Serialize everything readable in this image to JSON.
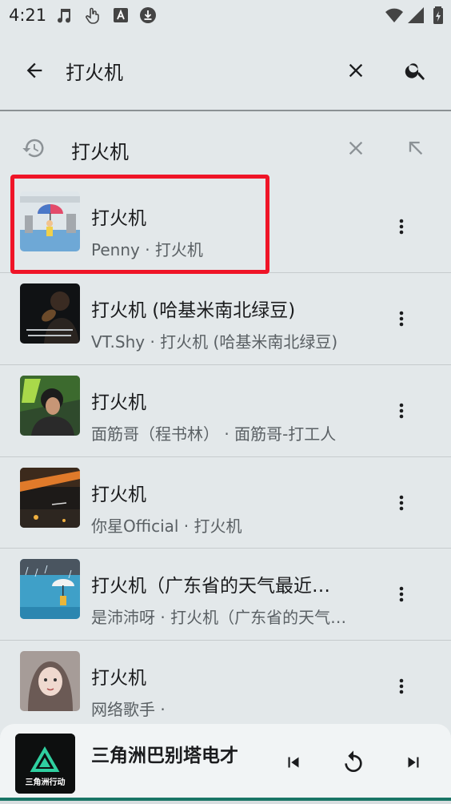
{
  "status_bar": {
    "time": "4:21",
    "left_icons": [
      "music-note-icon",
      "touch-hand-icon",
      "font-a-icon",
      "download-icon"
    ],
    "right_icons": [
      "wifi-icon",
      "cellular-signal-icon",
      "battery-icon"
    ]
  },
  "search": {
    "query": "打火机",
    "back_icon": "arrow-back-icon",
    "clear_icon": "close-icon",
    "search_icon": "search-icon"
  },
  "history": {
    "label": "打火机",
    "history_icon": "history-icon",
    "remove_icon": "close-icon",
    "fill_icon": "arrow-up-left-icon"
  },
  "results": [
    {
      "title": "打火机",
      "subtitle": "Penny · 打火机",
      "highlighted": true
    },
    {
      "title": "打火机 (哈基米南北绿豆)",
      "subtitle": "VT.Shy · 打火机 (哈基米南北绿豆)"
    },
    {
      "title": "打火机",
      "subtitle": "面筋哥（程书林） · 面筋哥-打工人"
    },
    {
      "title": "打火机",
      "subtitle": "你星Official · 打火机"
    },
    {
      "title": "打火机（广东省的天气最近…",
      "subtitle": "是沛沛呀 · 打火机（广东省的天气…"
    },
    {
      "title": "打火机",
      "subtitle": "网络歌手 ·"
    }
  ],
  "now_playing": {
    "title": "三角洲巴别塔电才",
    "art_text": "三角洲行动",
    "prev_icon": "skip-previous-icon",
    "replay_icon": "replay-icon",
    "next_icon": "skip-next-icon",
    "accent_color": "#1a7566"
  },
  "colors": {
    "background": "#e3e8ea",
    "highlight": "#ef1427"
  }
}
